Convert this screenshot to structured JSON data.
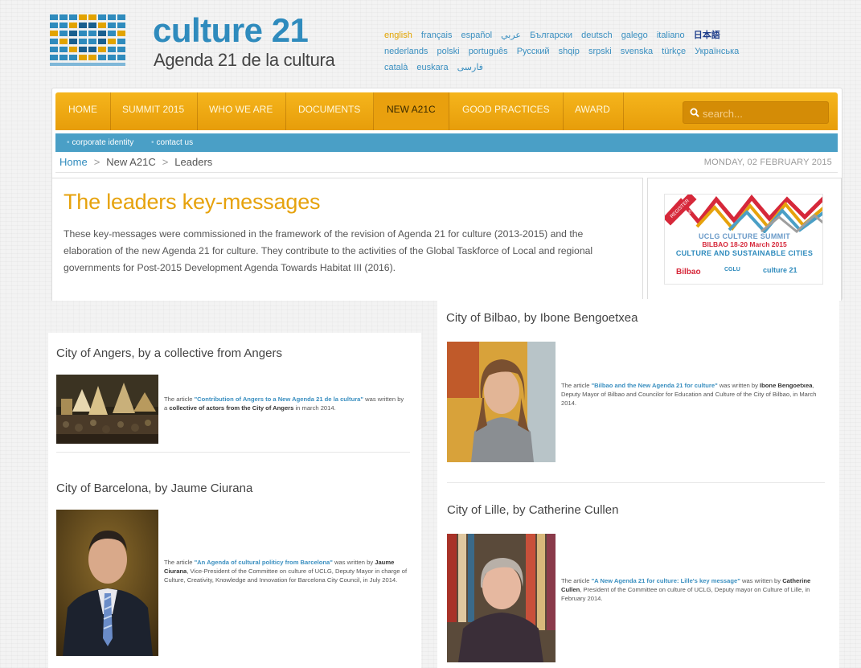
{
  "header": {
    "title": "culture 21",
    "subtitle": "Agenda 21 de la cultura",
    "languages": [
      "english",
      "français",
      "español",
      "عربي",
      "Български",
      "deutsch",
      "galego",
      "italiano",
      "日本語",
      "nederlands",
      "polski",
      "português",
      "Русский",
      "shqip",
      "srpski",
      "svenska",
      "türkçe",
      "Українська",
      "català",
      "euskara",
      "فارسی"
    ],
    "active_language": "english"
  },
  "nav": {
    "items": [
      "HOME",
      "SUMMIT 2015",
      "WHO WE ARE",
      "DOCUMENTS",
      "NEW A21C",
      "GOOD PRACTICES",
      "AWARD"
    ],
    "active": "NEW A21C",
    "search_placeholder": "search..."
  },
  "subnav": {
    "items": [
      "corporate identity",
      "contact us"
    ]
  },
  "breadcrumb": {
    "home": "Home",
    "section": "New A21C",
    "current": "Leaders",
    "separator": ">"
  },
  "date": "MONDAY, 02 FEBRUARY 2015",
  "main": {
    "title": "The leaders key-messages",
    "intro": "These key-messages were commissioned in the framework of the revision of Agenda 21 for culture (2013-2015) and the elaboration of the new Agenda 21 for culture. They contribute to the activities of the Global Taskforce of Local and regional governments for Post-2015 Development Agenda Towards Habitat III (2016)."
  },
  "banner": {
    "ribbon": "REGISTER NOW!",
    "line1": "UCLG CULTURE SUMMIT",
    "line2_city": "BILBAO",
    "line2_dates": " 18-20 March 2015",
    "line3": "CULTURE AND SUSTAINABLE CITIES",
    "logo_bilbao": "Bilbao",
    "logo_cglu": "CGLU",
    "logo_culture21": "culture 21"
  },
  "leaders": {
    "angers": {
      "heading": "City of Angers, by a collective from Angers",
      "pre": "The article ",
      "article": "\"Contribution of Angers to a New Agenda 21 de la cultura\"",
      "mid": " was written by a ",
      "author": "collective of actors from the City of Angers",
      "post": " in march 2014."
    },
    "barcelona": {
      "heading": "City of Barcelona, by Jaume Ciurana",
      "pre": "The article ",
      "article": "\"An Agenda of cultural politicy from Barcelona\"",
      "mid": " was written by ",
      "author": "Jaume Ciurana",
      "post": ", Vice-President of the Committee on culture of UCLG, Deputy Mayor in charge of Culture, Creativity, Knowledge and Innovation for Barcelona City Council, in July 2014."
    },
    "bilbao": {
      "heading": "City of Bilbao, by Ibone Bengoetxea",
      "pre": "The article ",
      "article": "\"Bilbao and the New Agenda 21 for culture\"",
      "mid": " was written by ",
      "author": "Ibone Bengoetxea",
      "post": ", Deputy Mayor of Bilbao and Councilor for Education and Culture of the City of Bilbao, in March 2014."
    },
    "lille": {
      "heading": "City of Lille, by Catherine Cullen",
      "pre": "The article ",
      "article": "\"A New Agenda 21 for culture: Lille's key message\"",
      "mid": " was written by ",
      "author": "Catherine Cullen",
      "post": ", President of the Committee on culture of UCLG, Deputy mayor on Culture of Lille, in February 2014."
    }
  },
  "colors": {
    "brand_blue": "#2f8bbd",
    "accent_orange": "#e6a20c",
    "subnav_blue": "#4a9fc6"
  }
}
